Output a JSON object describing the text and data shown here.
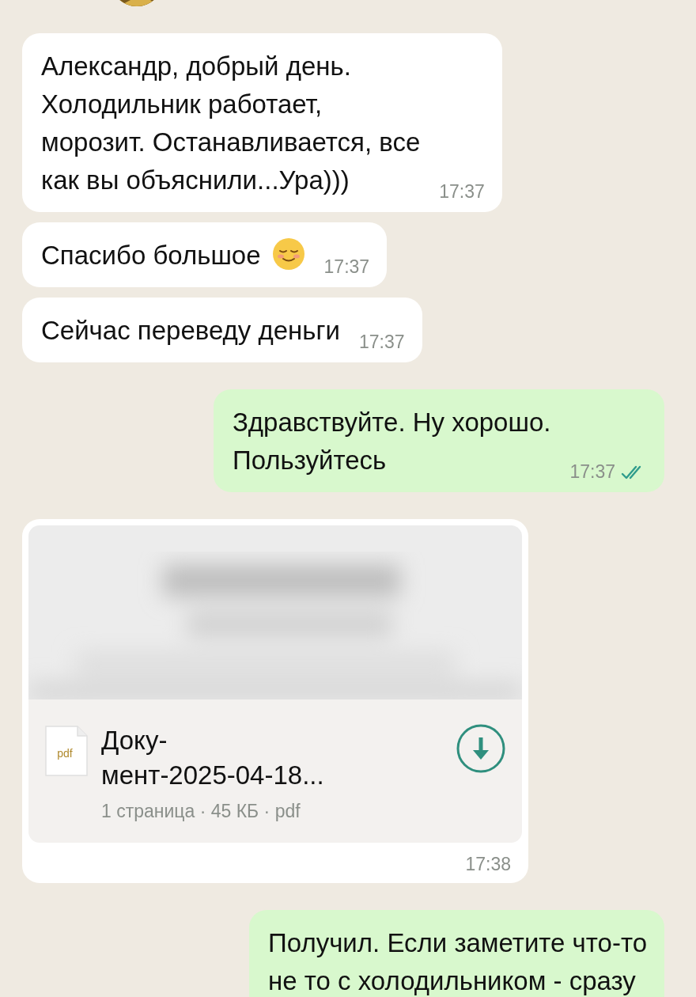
{
  "messages": [
    {
      "kind": "text",
      "outgoing": false,
      "text": "Александр, добрый день.\nХолодильник работает,\nморозит. Останавливается, все\nкак вы объяснили...Ура)))",
      "time": "17:37"
    },
    {
      "kind": "text",
      "outgoing": false,
      "text": "Спасибо большое",
      "emoji": true,
      "time": "17:37"
    },
    {
      "kind": "text",
      "outgoing": false,
      "text": "Сейчас переведу деньги",
      "time": "17:37"
    },
    {
      "kind": "text",
      "outgoing": true,
      "text": "Здравствуйте. Ну хорошо.\nПользуйтесь",
      "time": "17:37",
      "read": true
    },
    {
      "kind": "document",
      "outgoing": false,
      "file_type": "pdf",
      "name": "Доку-\nмент-2025-04-18...",
      "meta": "1 страница · 45 КБ · pdf",
      "time": "17:38"
    },
    {
      "kind": "text",
      "outgoing": true,
      "text": "Получил. Если заметите что-то\nне то с холодильником - сразу"
    }
  ]
}
